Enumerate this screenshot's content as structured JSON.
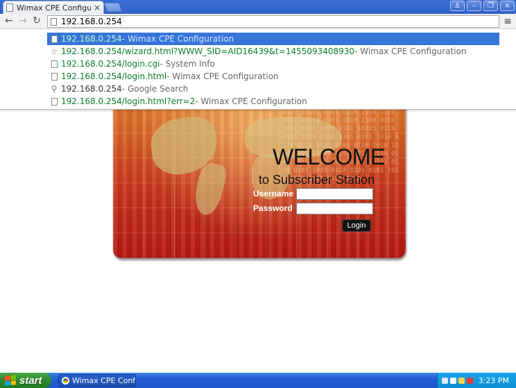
{
  "window": {
    "tab_title": "Wimax CPE Configuration",
    "tab_close": "×",
    "controls": {
      "user": "♙",
      "minimize": "–",
      "maximize": "❐",
      "close": "×"
    }
  },
  "toolbar": {
    "back": "←",
    "forward": "→",
    "reload": "↻",
    "address_value": "192.168.0.254",
    "menu": "≡"
  },
  "suggestions": [
    {
      "icon": "page-icon",
      "url": "192.168.0.254",
      "desc": " - Wimax CPE Configuration",
      "selected": true
    },
    {
      "icon": "star-icon",
      "url": "192.168.0.254/wizard.html?WWW_SID=AID16439&t=1455093408930",
      "desc": " - Wimax CPE Configuration"
    },
    {
      "icon": "page-icon",
      "url": "192.168.0.254/login.cgi",
      "desc": " - System Info"
    },
    {
      "icon": "page-icon",
      "url": "192.168.0.254/login.html",
      "desc": " - Wimax CPE Configuration"
    },
    {
      "icon": "search-icon",
      "plain": "192.168.0.254",
      "desc": " - Google Search"
    },
    {
      "icon": "page-icon",
      "url": "192.168.0.254/login.html?err=2",
      "desc": " - Wimax CPE Configuration"
    }
  ],
  "login": {
    "welcome": "WELCOME",
    "subtitle": "to Subscriber Station",
    "username_label": "Username",
    "password_label": "Password",
    "username_value": "",
    "password_value": "",
    "login_button": "Login",
    "binary_text": "0110 10101 0101 0110 1010 1100 0101 10110 0101 1010 1100 0101 1011 0110 1010 0101 10101 0110 0101 1010 0110 1101 0101 1010 0110 1010 1101 0101 0110 1010 1100 0101 10110 0101 1010 1100 0101 1011 0110 1010 0101 10101 0110 0101 1010 0110 1101 0101 1010 0110 1010 0101 1010"
  },
  "taskbar": {
    "start_label": "start",
    "task_label": "Wimax CPE Confi...",
    "clock": "3:23 PM"
  },
  "colors": {
    "selection": "#3775d9",
    "url_green": "#0a7d2a",
    "taskbar_blue": "#245ed7",
    "start_green": "#2e8a2e"
  }
}
